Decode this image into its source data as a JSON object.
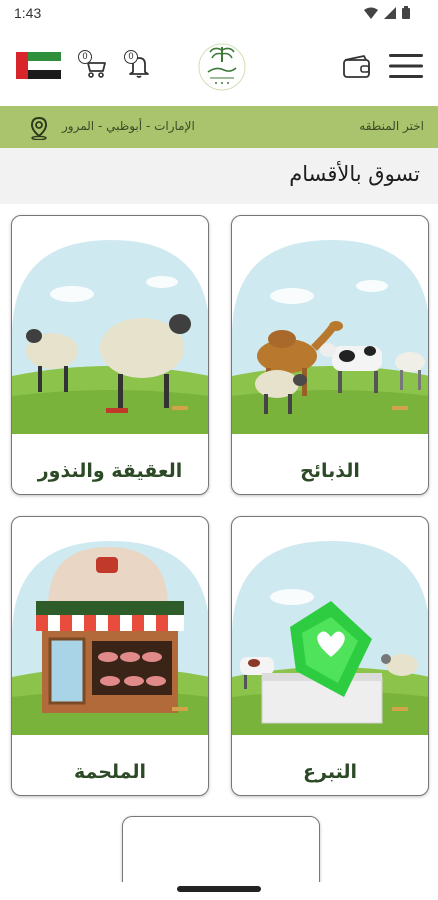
{
  "status_bar": {
    "time": "1:43",
    "icons": [
      "wifi-icon",
      "signal-icon",
      "battery-icon"
    ]
  },
  "header": {
    "flag": "uae-flag-icon",
    "cart_count": "0",
    "notification_count": "0",
    "logo": "halal-logo",
    "wallet": "wallet-icon",
    "menu": "hamburger-menu-icon"
  },
  "region": {
    "select_label": "اختر المنطقه",
    "value": "الإمارات - أبوظبي - المرور",
    "icon": "location-pin-icon"
  },
  "section": {
    "title": "تسوق بالأقسام"
  },
  "categories": [
    {
      "label": "الذبائح"
    },
    {
      "label": "العقيقة والنذور"
    },
    {
      "label": "التبرع"
    },
    {
      "label": "الملحمة"
    }
  ],
  "colors": {
    "accent_green": "#a9c46d",
    "label_green": "#2d4a27",
    "sky": "#cfe9f0",
    "grass": "#8cc34a"
  }
}
